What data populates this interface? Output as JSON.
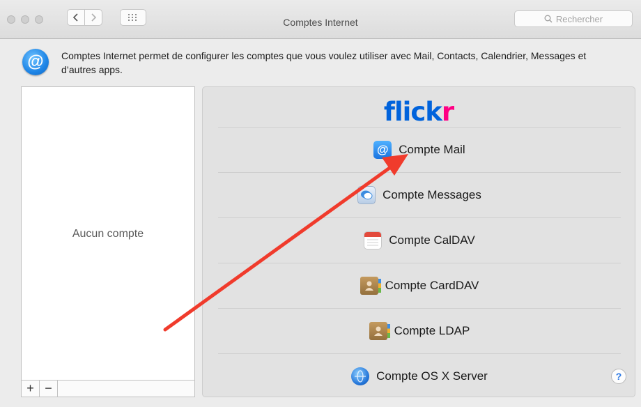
{
  "window": {
    "title": "Comptes Internet",
    "search_placeholder": "Rechercher",
    "grid_icon": "grid-icon"
  },
  "description": {
    "icon": "at-icon",
    "icon_glyph": "@",
    "text": "Comptes Internet permet de configurer les comptes que vous voulez utiliser avec Mail, Contacts, Calendrier, Messages et d’autres apps."
  },
  "accounts": {
    "empty_label": "Aucun compte",
    "add_label": "+",
    "remove_label": "−"
  },
  "providers": {
    "brand_prefix": "flick",
    "brand_suffix": "r",
    "brand_colors": {
      "primary": "#0063dc",
      "secondary": "#ff0084"
    },
    "items": [
      {
        "label": "Compte Mail",
        "icon": "mail-at-icon"
      },
      {
        "label": "Compte Messages",
        "icon": "messages-icon"
      },
      {
        "label": "Compte CalDAV",
        "icon": "calendar-icon"
      },
      {
        "label": "Compte CardDAV",
        "icon": "contacts-book-icon"
      },
      {
        "label": "Compte LDAP",
        "icon": "contacts-book-icon"
      },
      {
        "label": "Compte OS X Server",
        "icon": "globe-server-icon"
      }
    ],
    "help_label": "?"
  },
  "annotation": {
    "color": "#f03b2c"
  }
}
